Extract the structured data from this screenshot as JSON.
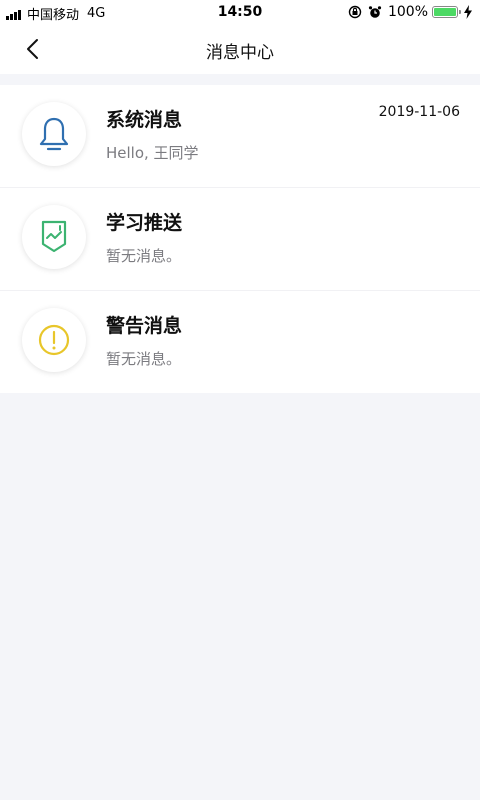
{
  "status_bar": {
    "carrier": "中国移动",
    "network": "4G",
    "time": "14:50",
    "battery_percent": "100%",
    "battery_color": "#4cd964",
    "icons": [
      "signal-icon",
      "rotation-lock-icon",
      "alarm-icon",
      "battery-icon",
      "charging-icon"
    ]
  },
  "nav": {
    "title": "消息中心",
    "back_icon": "chevron-left-icon"
  },
  "messages": [
    {
      "title": "系统消息",
      "preview": "Hello, 王同学",
      "date": "2019-11-06",
      "icon": "bell-icon",
      "icon_color": "#2f6fb0"
    },
    {
      "title": "学习推送",
      "preview": "暂无消息。",
      "date": "",
      "icon": "study-push-icon",
      "icon_color": "#3cb371"
    },
    {
      "title": "警告消息",
      "preview": "暂无消息。",
      "date": "",
      "icon": "warning-icon",
      "icon_color": "#e8c62a"
    }
  ]
}
